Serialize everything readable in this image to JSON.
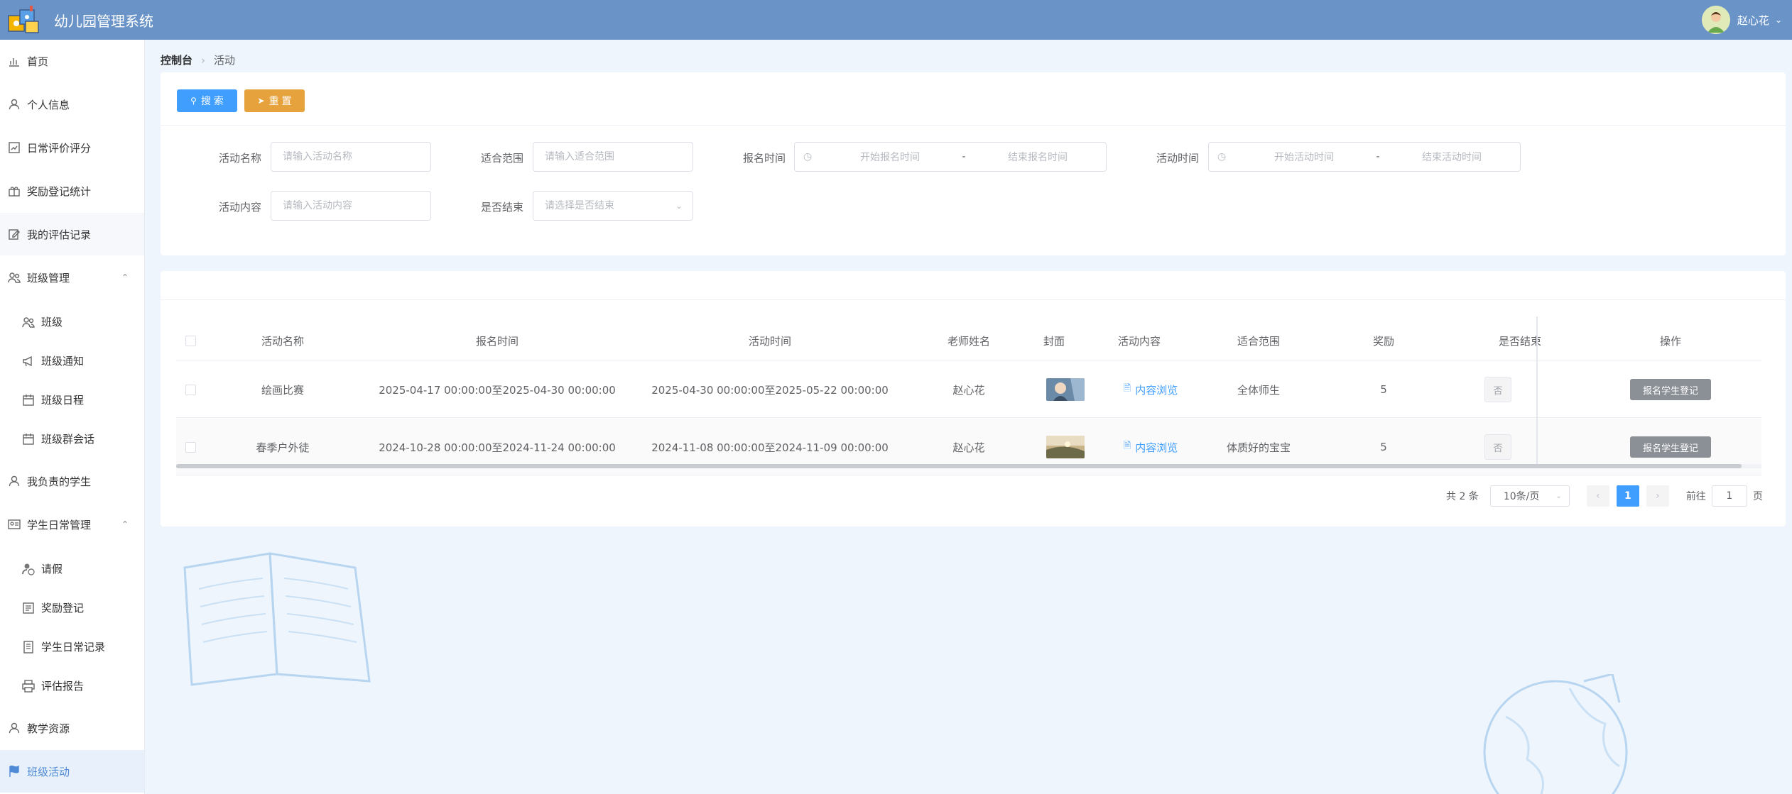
{
  "app": {
    "title": "幼儿园管理系统"
  },
  "user": {
    "name": "赵心花"
  },
  "sidebar": {
    "items": [
      {
        "label": "首页",
        "icon": "chart-icon"
      },
      {
        "label": "个人信息",
        "icon": "user-icon"
      },
      {
        "label": "日常评价评分",
        "icon": "bar-chart-icon"
      },
      {
        "label": "奖励登记统计",
        "icon": "gift-icon"
      },
      {
        "label": "我的评估记录",
        "icon": "edit-icon"
      },
      {
        "label": "班级管理",
        "icon": "users-icon"
      },
      {
        "label": "班级",
        "icon": "users-icon"
      },
      {
        "label": "班级通知",
        "icon": "megaphone-icon"
      },
      {
        "label": "班级日程",
        "icon": "calendar-icon"
      },
      {
        "label": "班级群会话",
        "icon": "calendar-icon"
      },
      {
        "label": "我负责的学生",
        "icon": "user-icon"
      },
      {
        "label": "学生日常管理",
        "icon": "id-card-icon"
      },
      {
        "label": "请假",
        "icon": "user-clock-icon"
      },
      {
        "label": "奖励登记",
        "icon": "form-icon"
      },
      {
        "label": "学生日常记录",
        "icon": "list-icon"
      },
      {
        "label": "评估报告",
        "icon": "printer-icon"
      },
      {
        "label": "教学资源",
        "icon": "user-icon"
      },
      {
        "label": "班级活动",
        "icon": "flag-icon"
      }
    ]
  },
  "breadcrumb": {
    "home": "控制台",
    "current": "活动"
  },
  "search": {
    "search_label": "搜 索",
    "reset_label": "重 置",
    "fields": {
      "name_label": "活动名称",
      "name_placeholder": "请输入活动名称",
      "scope_label": "适合范围",
      "scope_placeholder": "请输入适合范围",
      "signup_label": "报名时间",
      "signup_start": "开始报名时间",
      "signup_end": "结束报名时间",
      "activity_label": "活动时间",
      "activity_start": "开始活动时间",
      "activity_end": "结束活动时间",
      "content_label": "活动内容",
      "content_placeholder": "请输入活动内容",
      "ended_label": "是否结束",
      "ended_placeholder": "请选择是否结束",
      "range_sep": "-"
    }
  },
  "table": {
    "headers": [
      "活动名称",
      "报名时间",
      "活动时间",
      "老师姓名",
      "封面",
      "活动内容",
      "适合范围",
      "奖励",
      "是否结束",
      "操作"
    ],
    "rows": [
      {
        "name": "绘画比赛",
        "signup": "2025-04-17 00:00:00至2025-04-30 00:00:00",
        "activity": "2025-04-30 00:00:00至2025-05-22 00:00:00",
        "teacher": "赵心花",
        "content": "内容浏览",
        "scope": "全体师生",
        "reward": "5",
        "ended": "否",
        "action": "报名学生登记"
      },
      {
        "name": "春季户外徒",
        "signup": "2024-10-28 00:00:00至2024-11-24 00:00:00",
        "activity": "2024-11-08 00:00:00至2024-11-09 00:00:00",
        "teacher": "赵心花",
        "content": "内容浏览",
        "scope": "体质好的宝宝",
        "reward": "5",
        "ended": "否",
        "action": "报名学生登记"
      }
    ]
  },
  "pagination": {
    "total": "共 2 条",
    "page_size": "10条/页",
    "current": "1",
    "goto_label": "前往",
    "goto_value": "1",
    "page_unit": "页"
  },
  "colors": {
    "header": "#6a94c8",
    "primary": "#409eff",
    "reset": "#e6a23c"
  }
}
